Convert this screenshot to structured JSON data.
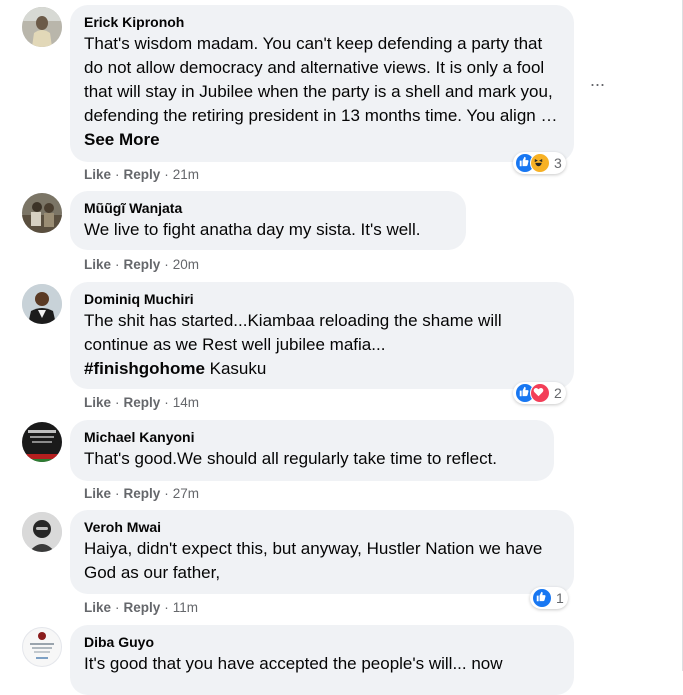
{
  "actions": {
    "like": "Like",
    "reply": "Reply",
    "separator": "·"
  },
  "comments": [
    {
      "author": "Erick Kipronoh",
      "text_main": "That's wisdom madam. You can't keep defending a party that do not allow democracy and alternative views. It is only a fool that will stay in Jubilee when the party is a shell and mark you, defending the retiring president in 13 months time. You align …",
      "see_more": "See More",
      "time": "21m",
      "reactions": [
        "like-icon",
        "haha-icon"
      ],
      "reaction_count": "3"
    },
    {
      "author": "Mũũgĩ Wanjata",
      "text_main": "We live to fight anatha day my sista. It's well.",
      "time": "20m"
    },
    {
      "author": "Dominiq Muchiri",
      "text_main": "The shit has started...Kiambaa reloading the shame will continue as we Rest well jubilee mafia...",
      "hashtag": "#finishgohome",
      "tag_name": "Kasuku",
      "time": "14m",
      "reactions": [
        "like-icon",
        "love-icon"
      ],
      "reaction_count": "2"
    },
    {
      "author": "Michael Kanyoni",
      "text_main": "That's good.We should all regularly take time to reflect.",
      "time": "27m"
    },
    {
      "author": "Veroh Mwai",
      "text_main": "Haiya, didn't expect this, but anyway, Hustler Nation we have God as our father,",
      "time": "11m",
      "reactions": [
        "like-icon"
      ],
      "reaction_count": "1"
    },
    {
      "author": "Diba Guyo",
      "text_main": "It's good that you have accepted the people's will... now"
    }
  ],
  "more_options": "···",
  "colors": {
    "like_blue": "#1877f2",
    "love_red": "#f33e58",
    "haha_yellow": "#f7b125",
    "bubble": "#f0f2f5",
    "meta_gray": "#65676b"
  }
}
